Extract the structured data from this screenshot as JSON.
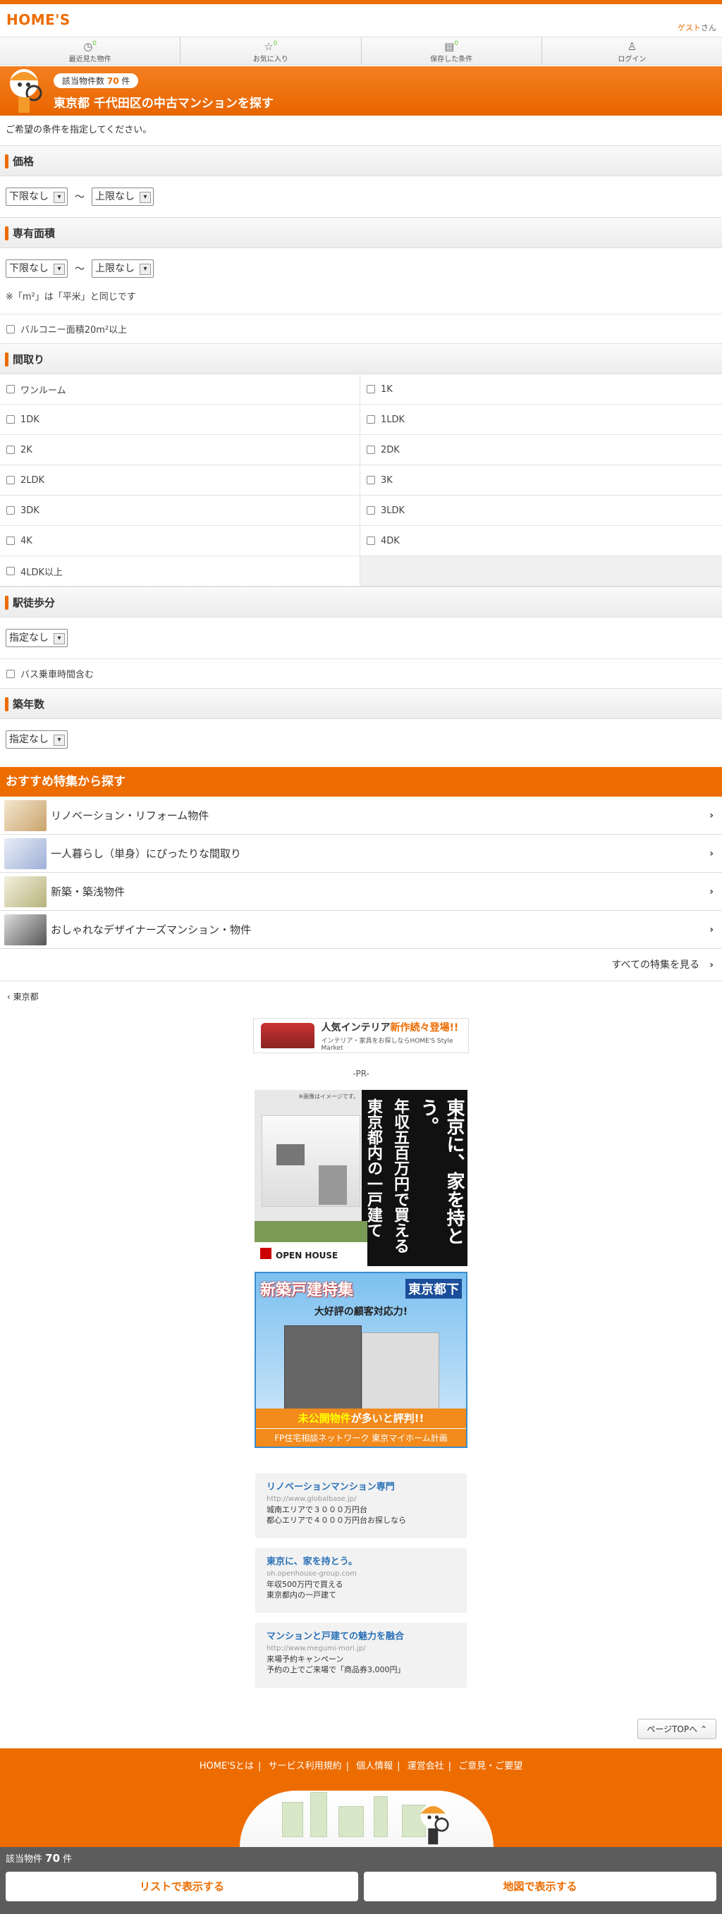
{
  "header": {
    "logo": "HOME'S",
    "guest_link": "ゲスト",
    "guest_suffix": "さん"
  },
  "nav": [
    {
      "label": "最近見た物件",
      "count": "0",
      "icon": "clock-icon"
    },
    {
      "label": "お気に入り",
      "count": "0",
      "icon": "star-icon"
    },
    {
      "label": "保存した条件",
      "count": "0",
      "icon": "document-icon"
    },
    {
      "label": "ログイン",
      "count": "",
      "icon": "user-icon"
    }
  ],
  "hero": {
    "count_prefix": "該当物件数",
    "count": "70",
    "count_suffix": "件",
    "title": "東京都 千代田区の中古マンションを探す"
  },
  "intro": "ご希望の条件を指定してください。",
  "price": {
    "title": "価格",
    "min": "下限なし",
    "tilde": "〜",
    "max": "上限なし"
  },
  "area": {
    "title": "専有面積",
    "min": "下限なし",
    "tilde": "〜",
    "max": "上限なし",
    "note": "※「m²」は「平米」と同じです",
    "balcony": "バルコニー面積20m²以上"
  },
  "layout": {
    "title": "間取り",
    "options": [
      "ワンルーム",
      "1K",
      "1DK",
      "1LDK",
      "2K",
      "2DK",
      "2LDK",
      "3K",
      "3DK",
      "3LDK",
      "4K",
      "4DK",
      "4LDK以上"
    ]
  },
  "walk": {
    "title": "駅徒歩分",
    "value": "指定なし",
    "bus": "バス乗車時間含む"
  },
  "age": {
    "title": "築年数",
    "value": "指定なし"
  },
  "recommend": {
    "title": "おすすめ特集から探す",
    "items": [
      "リノベーション・リフォーム物件",
      "一人暮らし（単身）にぴったりな間取り",
      "新築・築浅物件",
      "おしゃれなデザイナーズマンション・物件"
    ],
    "all": "すべての特集を見る"
  },
  "back": "東京都",
  "banner_small": {
    "title": "人気インテリア",
    "highlight": "新作続々登場!!",
    "sub": "インテリア・家具をお探しならHOME'S Style Market"
  },
  "pr": "-PR-",
  "ad1": {
    "note": "※画像はイメージです。",
    "line1": "東京に、家を持とう。",
    "line2": "年収五百万円で買える",
    "line3": "東京都内の一戸建て",
    "brand": "OPEN HOUSE"
  },
  "ad2": {
    "head": "新築戸建特集",
    "area": "東京都下",
    "sub": "大好評の顧客対応力!",
    "cap1": "未公開物件",
    "cap2": "が多いと評判!!",
    "foot": "FP住宅相談ネットワーク 東京マイホーム計画"
  },
  "text_ads": [
    {
      "title": "リノベーションマンション専門",
      "url": "http://www.globalbase.jp/",
      "desc1": "城南エリアで３０００万円台",
      "desc2": "都心エリアで４０００万円台お探しなら"
    },
    {
      "title": "東京に、家を持とう。",
      "url": "oh.openhouse-group.com",
      "desc1": "年収500万円で買える",
      "desc2": "東京都内の一戸建て"
    },
    {
      "title": "マンションと戸建ての魅力を融合",
      "url": "http://www.megumi-mori.jp/",
      "desc1": "来場予約キャンペーン",
      "desc2": "予約の上でご来場で「商品券3,000円」"
    }
  ],
  "page_top": "ページTOPへ",
  "footer_links": [
    "HOME'Sとは",
    "サービス利用規約",
    "個人情報",
    "運営会社",
    "ご意見・ご要望"
  ],
  "bottom": {
    "label": "該当物件",
    "count": "70",
    "suffix": "件",
    "list_btn": "リストで表示する",
    "map_btn": "地図で表示する"
  },
  "colors": {
    "brand": "#ed6c00",
    "count_green": "#66cc33",
    "link_blue": "#2b72b8"
  }
}
